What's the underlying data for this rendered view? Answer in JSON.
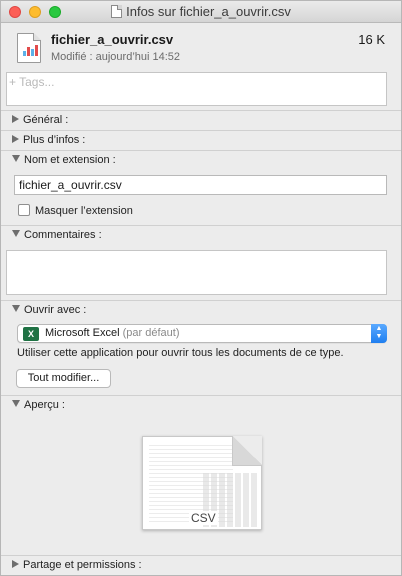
{
  "window": {
    "title": "Infos sur fichier_a_ouvrir.csv"
  },
  "file": {
    "name": "fichier_a_ouvrir.csv",
    "size": "16 K",
    "modified": "Modifié : aujourd’hui 14:52"
  },
  "tags": {
    "placeholder": "+ Tags..."
  },
  "sections": {
    "general": "Général :",
    "more_info": "Plus d’infos :",
    "name_ext": "Nom et extension :",
    "comments": "Commentaires :",
    "open_with": "Ouvrir avec :",
    "preview": "Aperçu :",
    "sharing": "Partage et permissions :"
  },
  "name_field": {
    "value": "fichier_a_ouvrir.csv"
  },
  "hide_extension": {
    "label": "Masquer l’extension",
    "checked": false
  },
  "open_with": {
    "app_icon": "X",
    "app": "Microsoft Excel",
    "default_note": "(par défaut)",
    "description": "Utiliser cette application pour ouvrir tous les documents de ce type.",
    "change_all": "Tout modifier..."
  },
  "preview": {
    "label": "CSV"
  },
  "colors": {
    "accent": "#1f7ff0",
    "excel": "#1f7244"
  }
}
